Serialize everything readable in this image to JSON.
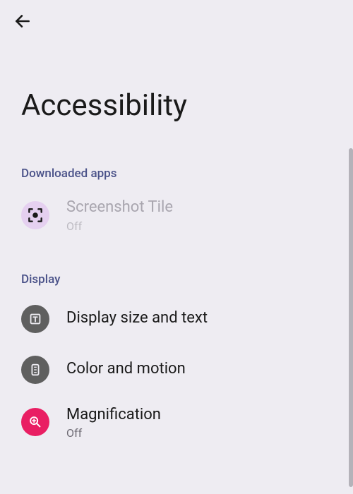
{
  "page": {
    "title": "Accessibility"
  },
  "sections": {
    "downloaded": {
      "header": "Downloaded apps",
      "items": [
        {
          "title": "Screenshot Tile",
          "subtitle": "Off"
        }
      ]
    },
    "display": {
      "header": "Display",
      "items": [
        {
          "title": "Display size and text",
          "subtitle": ""
        },
        {
          "title": "Color and motion",
          "subtitle": ""
        },
        {
          "title": "Magnification",
          "subtitle": "Off"
        }
      ]
    }
  }
}
